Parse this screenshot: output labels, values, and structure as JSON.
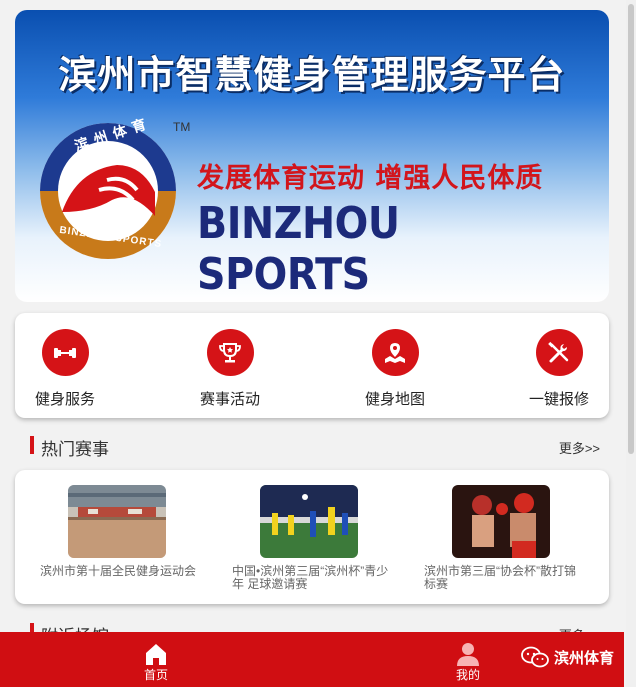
{
  "banner": {
    "title": "滨州市智慧健身管理服务平台",
    "slogan": "发展体育运动  增强人民体质",
    "english": "BINZHOU SPORTS",
    "logo_text_top": "滨州体育",
    "logo_text_bottom": "BINZHOU SPORTS",
    "tm": "TM"
  },
  "quick_menu": [
    {
      "label": "健身服务",
      "icon": "dumbbell-icon"
    },
    {
      "label": "赛事活动",
      "icon": "trophy-icon"
    },
    {
      "label": "健身地图",
      "icon": "map-icon"
    },
    {
      "label": "一键报修",
      "icon": "tools-icon"
    }
  ],
  "hot_events": {
    "title": "热门赛事",
    "more": "更多>>",
    "items": [
      {
        "caption": "滨州市第十届全民健身运动会"
      },
      {
        "caption": "中国•滨州第三届“滨州杯”青少年 足球邀请赛"
      },
      {
        "caption": "滨州市第三届“协会杯”散打锦标赛"
      }
    ]
  },
  "nearby": {
    "title": "附近场馆",
    "more": "更多>>"
  },
  "tabbar": {
    "home": "首页",
    "mine": "我的",
    "wechat": "滨州体育"
  },
  "colors": {
    "accent": "#d51317",
    "tabbar": "#d00e12"
  }
}
